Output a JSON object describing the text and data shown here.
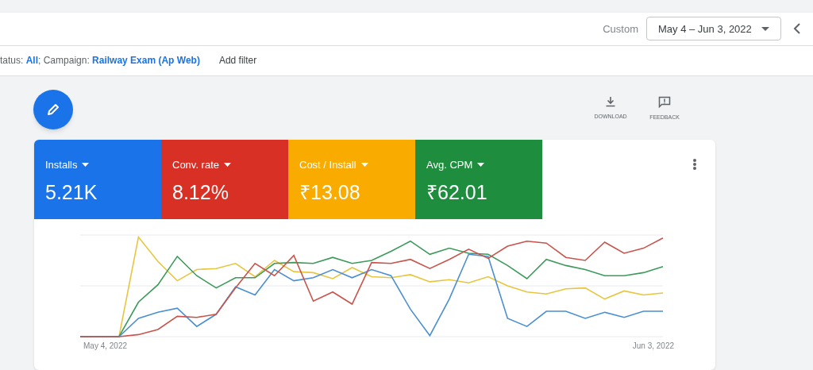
{
  "header": {
    "range_label": "Custom",
    "date_range": "May 4 – Jun 3, 2022"
  },
  "filter_bar": {
    "filters": "tatus: **All**; Campaign: **Railway Exam (Ap Web)**",
    "add_filter": "Add filter"
  },
  "toolbar": [
    "DOWNLOAD",
    "FEEDBACK"
  ],
  "metrics": [
    {
      "label": "Installs",
      "value": "5.21K",
      "color": "#1a73e8"
    },
    {
      "label": "Conv. rate",
      "value": "8.12%",
      "color": "#d93025"
    },
    {
      "label": "Cost / Install",
      "value": "₹13.08",
      "color": "#f9ab00"
    },
    {
      "label": "Avg. CPM",
      "value": "₹62.01",
      "color": "#1e8e3e"
    }
  ],
  "chart": {
    "x_start": "May 4, 2022",
    "x_end": "Jun 3, 2022"
  }
}
